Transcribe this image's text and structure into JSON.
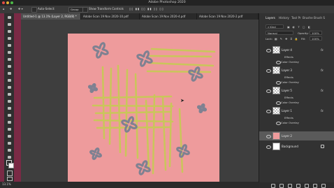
{
  "app": {
    "title": "Adobe Photoshop 2020"
  },
  "options_bar": {
    "auto_select_label": "Auto-Select:",
    "auto_select_value": "Group",
    "transform_label": "Show Transform Controls"
  },
  "document_tabs": [
    {
      "label": "Untitled-1 @ 13.1% (Layer 2, RGB/8) *"
    },
    {
      "label": "Adobe Scan 19 Nov 2020-10.pdf"
    },
    {
      "label": "Adobe Scan 19 Nov 2020-4.pdf"
    },
    {
      "label": "Adobe Scan 19 Nov 2020-2.pdf"
    }
  ],
  "panels": {
    "tabs": [
      "Layers",
      "History",
      "Tool Pr",
      "Brushe",
      "Brush S"
    ],
    "filter_kind": "Kind",
    "blend_mode": "Normal",
    "opacity_label": "Opacity:",
    "opacity_value": "100%",
    "lock_label": "Lock:",
    "fill_label": "Fill:",
    "fill_value": "100%"
  },
  "layers": [
    {
      "name": "Layer 4",
      "fx": "fx",
      "effects": "Effects",
      "effect": "Color Overlay"
    },
    {
      "name": "Layer 3",
      "fx": "fx",
      "effects": "Effects",
      "effect": "Color Overlay"
    },
    {
      "name": "Layer 5",
      "fx": "fx",
      "effects": "Effects",
      "effect": "Color Overlay"
    },
    {
      "name": "Layer 1",
      "fx": "fx",
      "effects": "Effects",
      "effect": "Color Overlay"
    },
    {
      "name": "Layer 2"
    },
    {
      "name": "Background"
    }
  ],
  "status": {
    "zoom": "13.1%"
  },
  "colors": {
    "canvas": "#ee9b9c",
    "stripe": "#c9c65a",
    "squiggle": "#7f8191",
    "foreground_swatch": "#29a0b8"
  }
}
